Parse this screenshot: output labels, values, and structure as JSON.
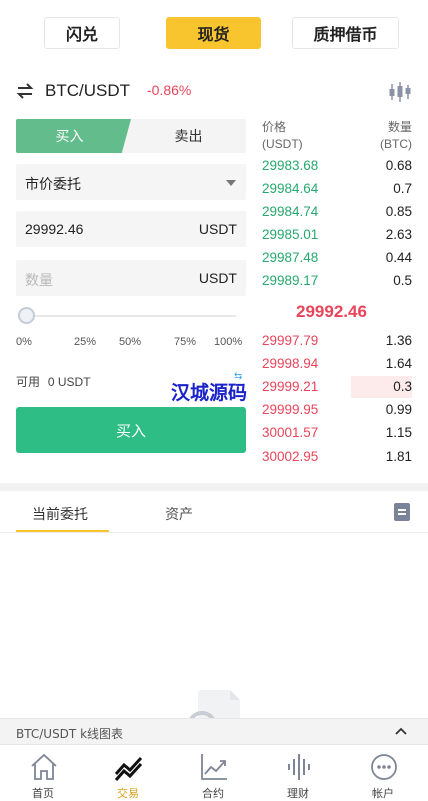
{
  "top_tabs": [
    {
      "label": "闪兑",
      "active": false
    },
    {
      "label": "现货",
      "active": true
    },
    {
      "label": "质押借币",
      "active": false
    }
  ],
  "pair": {
    "name": "BTC/USDT",
    "change": "-0.86%",
    "swap_icon": "swap-arrows-icon",
    "kline_icon": "candlestick-icon"
  },
  "trade": {
    "buy_tab": "买入",
    "sell_tab": "卖出",
    "order_type": "市价委托",
    "price_value": "29992.46",
    "price_unit": "USDT",
    "amount_placeholder": "数量",
    "amount_unit": "USDT",
    "percent_ticks": [
      "0%",
      "25%",
      "50%",
      "75%",
      "100%"
    ],
    "slider_fraction": 0,
    "available_label": "可用",
    "available_value": "0 USDT",
    "submit_label": "买入"
  },
  "watermark": {
    "text": "汉城源码",
    "mark": "⇆"
  },
  "orderbook": {
    "price_header": "价格",
    "price_unit": "(USDT)",
    "qty_header": "数量",
    "qty_unit": "(BTC)",
    "bids": [
      {
        "price": "29983.68",
        "qty": "0.68"
      },
      {
        "price": "29984.64",
        "qty": "0.7"
      },
      {
        "price": "29984.74",
        "qty": "0.85"
      },
      {
        "price": "29985.01",
        "qty": "2.63"
      },
      {
        "price": "29987.48",
        "qty": "0.44"
      },
      {
        "price": "29989.17",
        "qty": "0.5"
      }
    ],
    "last_price": "29992.46",
    "asks": [
      {
        "price": "29997.79",
        "qty": "1.36"
      },
      {
        "price": "29998.94",
        "qty": "1.64"
      },
      {
        "price": "29999.21",
        "qty": "0.3"
      },
      {
        "price": "29999.95",
        "qty": "0.99"
      },
      {
        "price": "30001.57",
        "qty": "1.15"
      },
      {
        "price": "30002.95",
        "qty": "1.81"
      }
    ],
    "colors": {
      "bid": "#27a86d",
      "ask": "#e8455b",
      "ask_depth": "#fdeaea",
      "bid_depth": "#e9f7ef"
    }
  },
  "orders": {
    "tab_current": "当前委托",
    "tab_assets": "资产",
    "doc_icon": "document-icon"
  },
  "kline_bar": {
    "label": "BTC/USDT k线图表",
    "icon": "chevron-up-icon"
  },
  "bottom_nav": [
    {
      "label": "首页",
      "icon": "home-icon",
      "active": false
    },
    {
      "label": "交易",
      "icon": "trade-icon",
      "active": true
    },
    {
      "label": "合约",
      "icon": "contract-chart-icon",
      "active": false
    },
    {
      "label": "理财",
      "icon": "finance-wave-icon",
      "active": false
    },
    {
      "label": "帐户",
      "icon": "account-icon",
      "active": false
    }
  ],
  "theme": {
    "accent": "#f9c52e",
    "buy_green": "#2ebd85",
    "sell_red": "#e8455b"
  }
}
